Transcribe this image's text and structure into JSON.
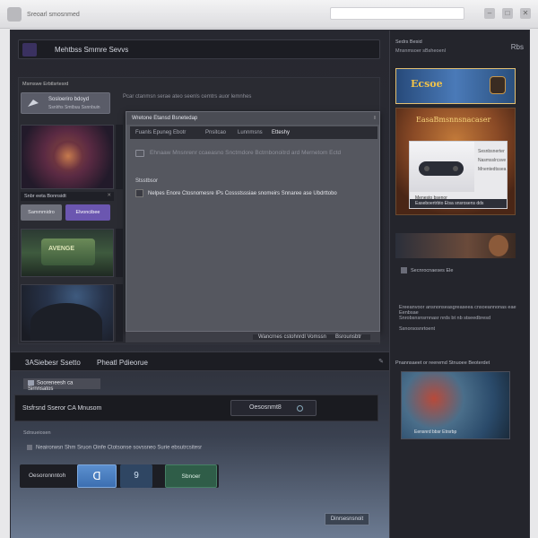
{
  "topbar": {
    "title": "Sreoarl smosnmed",
    "search_placeholder": "",
    "icons": [
      "minimize-icon",
      "maximize-icon",
      "close-icon"
    ]
  },
  "header": {
    "title": "Mehtbss Smmre Sevvs"
  },
  "left_panel": {
    "head": "Msmswe Erbtlsrtesrd",
    "subtitle": "Pcar ctanmsn serae ateo seenls cemtrs auor lemnhes",
    "button": {
      "line1": "Sosloeriro bdoyd",
      "line2": "Ssnlrhs Smtbuu Ssnnbuin"
    },
    "filter_tab": "Snbr eeta Bonnsidt",
    "filter_buttons": [
      "Sammmidro",
      "Elvoncibee"
    ],
    "game2_text": "AVENGE"
  },
  "dialog": {
    "title": "Wretone Etansd Bsnetedap",
    "tabs": [
      "Fuanls Epuneg Ebotr",
      "Pnsitcao",
      "Lunnmsns",
      "Etteshy"
    ],
    "line": "Ehnaaw Mnsnrenr ccaeasno Snctmdore Bctrnbonoitrd ard Mernetom Ectd",
    "label": "Stsstbsor",
    "option": "Nelpes Enore Ctosnomesre IPs Cossstsssiae snomeirs Snnaree ase Ubdrttobo",
    "footer": [
      "Wancrnes cstohnrdl Vomssnnrrsn",
      "Bsrounsbtr"
    ]
  },
  "section2": {
    "title_left": "3ASiebesr Ssetto",
    "title_right": "Pheatl Pdieorue",
    "label": "Sooreneesh ca Sirnnsatos",
    "bar_label": "Stsfrsnd Sseror CA Mnusom",
    "dropdown": "Oesosnmt8",
    "note1": "Sdrsueiosen",
    "note2": "Neairorwsn Shm Sruon Oinfe Ctotsonse sovssneo Surie ebsutrcsitesr",
    "actions": [
      "Oesoronnntoh",
      "ᗡ",
      "9",
      "Sbnoer"
    ],
    "corner_button": "Dinrsesnsnoit"
  },
  "right_panel": {
    "head1": "Sedrs Besid",
    "head2": "Mnsnmsoer sBsheoenl",
    "head3": "Rbs",
    "banner1_text": "Ecsoe",
    "banner2_text": "EasaBmsnnsnacaser",
    "card": {
      "lines": [
        "Sesnbsnerter",
        "Nasmsslrcsve",
        "Mnentedtssea"
      ],
      "caption": "Menesto bsenor",
      "footer": "Easeboertrbto Etsa snsrosens dds"
    },
    "tag": "Secnrocnaeses Ele",
    "paragraph": [
      "Ereeanvoor ansnonseasgreaseea cnsoeannonas eae Eenbsae",
      "Snrobsnsnsrnnasr nrds bt nb stseedbresd",
      "Ssnorsosnrtoent"
    ],
    "head4": "Pnannsaeet or reeremd Stnuoee Beoterdet",
    "shot_caption": "Eensnrd bbsr Etrsrbp"
  }
}
